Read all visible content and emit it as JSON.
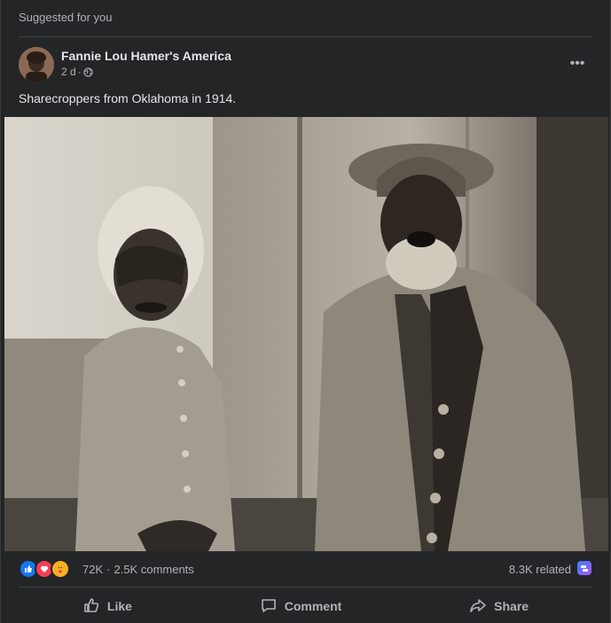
{
  "header": {
    "suggested_label": "Suggested for you"
  },
  "post": {
    "page_name": "Fannie Lou Hamer's America",
    "time": "2 d",
    "separator": "·",
    "caption": "Sharecroppers from Oklahoma in 1914.",
    "more_label": "•••"
  },
  "stats": {
    "reaction_count": "72K",
    "comments": "2.5K comments",
    "comments_sep": "·",
    "related": "8.3K related",
    "reaction_icons": [
      "like-icon",
      "love-icon",
      "care-icon"
    ]
  },
  "actions": {
    "like_label": "Like",
    "comment_label": "Comment",
    "share_label": "Share"
  },
  "colors": {
    "background": "#242526",
    "text_primary": "#e4e6eb",
    "text_secondary": "#b0b3b8",
    "like_blue": "#1877f2",
    "love_red": "#f33e58",
    "care_yellow": "#f7b125"
  }
}
